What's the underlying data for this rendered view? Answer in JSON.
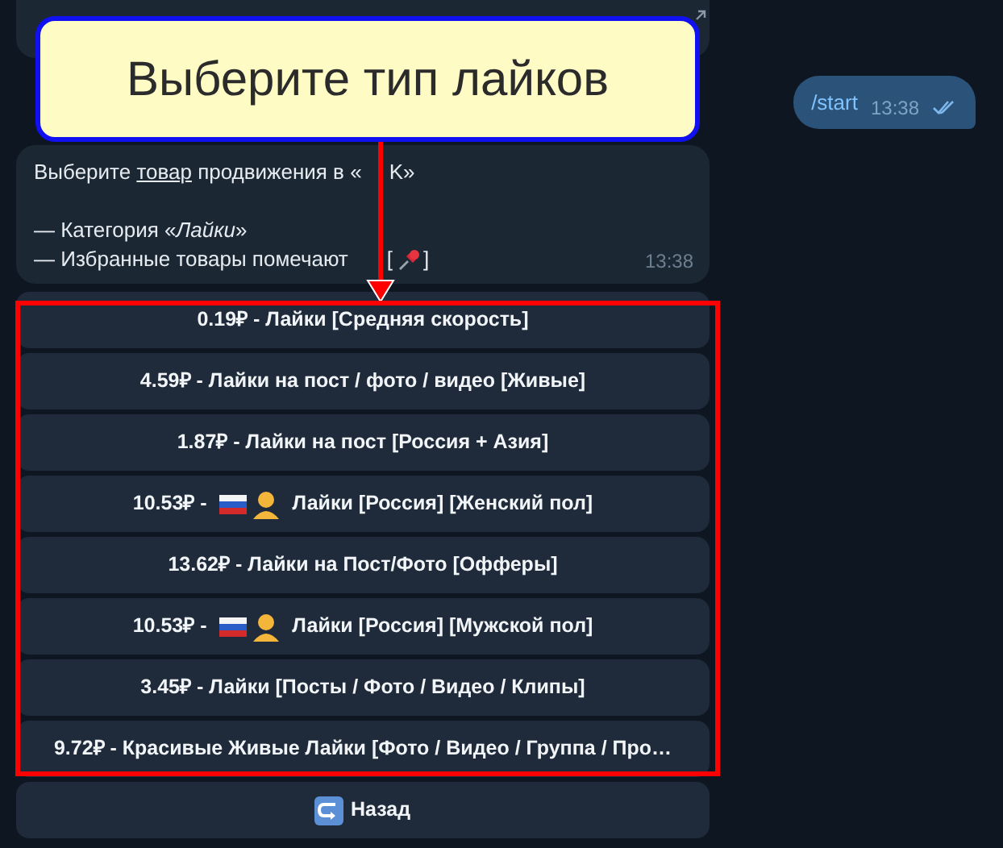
{
  "callout": {
    "text": "Выберите тип лайков"
  },
  "incoming_message": {
    "line_1": {
      "before": "Выберите ",
      "link": "товар",
      "after": " продвижения в «",
      "after_2": "K»"
    },
    "line_2": "— Категория «*Лайки*»",
    "line_3": {
      "before": "— Избранные товары помечают",
      "open": "[",
      "after": "]"
    },
    "time": "13:38"
  },
  "outgoing_message": {
    "text": "/start",
    "time": "13:38",
    "read": true
  },
  "keyboard": [
    {
      "kind": "plain",
      "price": "0.19₽",
      "label": "- Лайки [Средняя скорость]"
    },
    {
      "kind": "plain",
      "price": "4.59₽",
      "label": "- Лайки на пост / фото / видео [Живые]"
    },
    {
      "kind": "plain",
      "price": "1.87₽",
      "label": "- Лайки на пост [Россия + Азия]"
    },
    {
      "kind": "flag_person",
      "price": "10.53₽",
      "label": "-",
      "label_after": "Лайки [Россия] [Женский пол]"
    },
    {
      "kind": "plain",
      "price": "13.62₽",
      "label": "- Лайки на Пост/Фото [Офферы]"
    },
    {
      "kind": "flag_person",
      "price": "10.53₽",
      "label": "-",
      "label_after": "Лайки [Россия] [Мужской пол]"
    },
    {
      "kind": "plain",
      "price": "3.45₽",
      "label": "- Лайки [Посты / Фото / Видео / Клипы]"
    },
    {
      "kind": "plain",
      "price": "9.72₽",
      "label": "- Красивые Живые Лайки [Фото / Видео / Группа / Про…"
    },
    {
      "kind": "back",
      "label": "Назад"
    }
  ]
}
